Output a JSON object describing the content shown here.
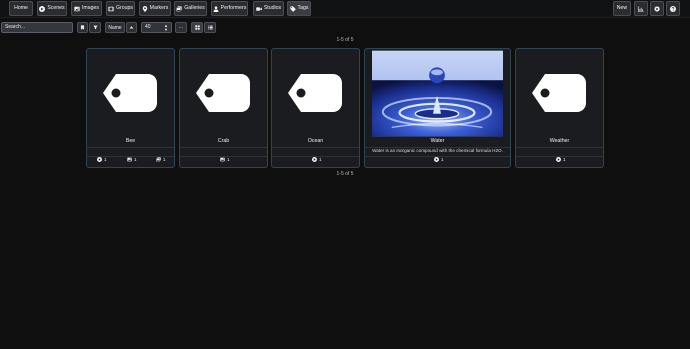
{
  "nav": {
    "items": [
      {
        "label": "Home",
        "icon": "none"
      },
      {
        "label": "Scenes",
        "icon": "play-circle-icon"
      },
      {
        "label": "Images",
        "icon": "image-icon"
      },
      {
        "label": "Groups",
        "icon": "film-icon"
      },
      {
        "label": "Markers",
        "icon": "map-marker-icon"
      },
      {
        "label": "Galleries",
        "icon": "images-icon"
      },
      {
        "label": "Performers",
        "icon": "user-icon"
      },
      {
        "label": "Studios",
        "icon": "video-icon"
      },
      {
        "label": "Tags",
        "icon": "tag-icon"
      }
    ],
    "new_label": "New",
    "right_icons": [
      "stats-chart-icon",
      "settings-cog-icon",
      "help-icon"
    ]
  },
  "toolbar": {
    "search_placeholder": "Search...",
    "sort_by": "Name",
    "per_page": "40",
    "more_label": "···"
  },
  "pagination": {
    "top": "1-5 of 5",
    "bottom": "1-5 of 5"
  },
  "accent_border": "#2d4656",
  "cards": [
    {
      "name": "Bee",
      "description": "",
      "counts": [
        {
          "icon": "play-circle-icon",
          "value": "1"
        },
        {
          "icon": "image-icon",
          "value": "1"
        },
        {
          "icon": "images-icon",
          "value": "1"
        }
      ]
    },
    {
      "name": "Crab",
      "description": "",
      "counts": [
        {
          "icon": "image-icon",
          "value": "1"
        }
      ]
    },
    {
      "name": "Ocean",
      "description": "",
      "counts": [
        {
          "icon": "play-circle-icon",
          "value": "1"
        }
      ]
    },
    {
      "name": "Water",
      "description": "Water is an inorganic compound with the chemical formula H2O.",
      "counts": [
        {
          "icon": "play-circle-icon",
          "value": "1"
        }
      ]
    },
    {
      "name": "Weather",
      "description": "",
      "counts": [
        {
          "icon": "play-circle-icon",
          "value": "1"
        }
      ]
    }
  ]
}
